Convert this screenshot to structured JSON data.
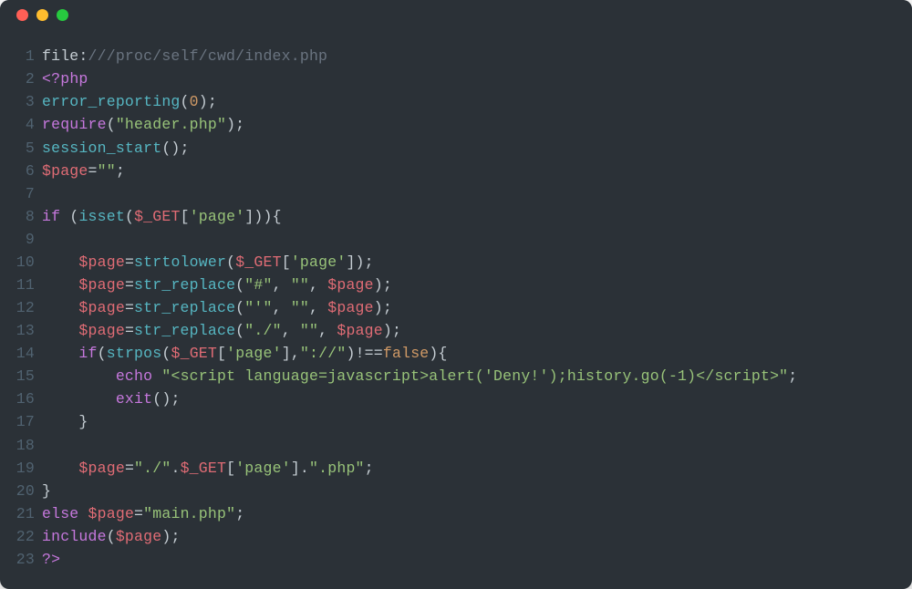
{
  "lines": [
    {
      "n": "1",
      "tokens": [
        {
          "t": "file:",
          "c": "c-plain"
        },
        {
          "t": "///proc/self/cwd/index.php",
          "c": "c-comment"
        }
      ]
    },
    {
      "n": "2",
      "tokens": [
        {
          "t": "<?",
          "c": "c-tag"
        },
        {
          "t": "php",
          "c": "c-tag"
        }
      ]
    },
    {
      "n": "3",
      "tokens": [
        {
          "t": "error_reporting",
          "c": "c-func"
        },
        {
          "t": "(",
          "c": "c-paren"
        },
        {
          "t": "0",
          "c": "c-number"
        },
        {
          "t": ");",
          "c": "c-paren"
        }
      ]
    },
    {
      "n": "4",
      "tokens": [
        {
          "t": "require",
          "c": "c-keyword"
        },
        {
          "t": "(",
          "c": "c-paren"
        },
        {
          "t": "\"header.php\"",
          "c": "c-string"
        },
        {
          "t": ");",
          "c": "c-paren"
        }
      ]
    },
    {
      "n": "5",
      "tokens": [
        {
          "t": "session_start",
          "c": "c-func"
        },
        {
          "t": "();",
          "c": "c-paren"
        }
      ]
    },
    {
      "n": "6",
      "tokens": [
        {
          "t": "$page",
          "c": "c-var"
        },
        {
          "t": "=",
          "c": "c-op"
        },
        {
          "t": "\"\"",
          "c": "c-string"
        },
        {
          "t": ";",
          "c": "c-paren"
        }
      ]
    },
    {
      "n": "7",
      "tokens": []
    },
    {
      "n": "8",
      "tokens": [
        {
          "t": "if",
          "c": "c-keyword"
        },
        {
          "t": " (",
          "c": "c-paren"
        },
        {
          "t": "isset",
          "c": "c-func"
        },
        {
          "t": "(",
          "c": "c-paren"
        },
        {
          "t": "$_GET",
          "c": "c-var"
        },
        {
          "t": "[",
          "c": "c-paren"
        },
        {
          "t": "'page'",
          "c": "c-string"
        },
        {
          "t": "])){",
          "c": "c-paren"
        }
      ]
    },
    {
      "n": "9",
      "tokens": []
    },
    {
      "n": "10",
      "tokens": [
        {
          "t": "    ",
          "c": "c-plain"
        },
        {
          "t": "$page",
          "c": "c-var"
        },
        {
          "t": "=",
          "c": "c-op"
        },
        {
          "t": "strtolower",
          "c": "c-func"
        },
        {
          "t": "(",
          "c": "c-paren"
        },
        {
          "t": "$_GET",
          "c": "c-var"
        },
        {
          "t": "[",
          "c": "c-paren"
        },
        {
          "t": "'page'",
          "c": "c-string"
        },
        {
          "t": "]);",
          "c": "c-paren"
        }
      ]
    },
    {
      "n": "11",
      "tokens": [
        {
          "t": "    ",
          "c": "c-plain"
        },
        {
          "t": "$page",
          "c": "c-var"
        },
        {
          "t": "=",
          "c": "c-op"
        },
        {
          "t": "str_replace",
          "c": "c-func"
        },
        {
          "t": "(",
          "c": "c-paren"
        },
        {
          "t": "\"#\"",
          "c": "c-string"
        },
        {
          "t": ", ",
          "c": "c-paren"
        },
        {
          "t": "\"\"",
          "c": "c-string"
        },
        {
          "t": ", ",
          "c": "c-paren"
        },
        {
          "t": "$page",
          "c": "c-var"
        },
        {
          "t": ");",
          "c": "c-paren"
        }
      ]
    },
    {
      "n": "12",
      "tokens": [
        {
          "t": "    ",
          "c": "c-plain"
        },
        {
          "t": "$page",
          "c": "c-var"
        },
        {
          "t": "=",
          "c": "c-op"
        },
        {
          "t": "str_replace",
          "c": "c-func"
        },
        {
          "t": "(",
          "c": "c-paren"
        },
        {
          "t": "\"'\"",
          "c": "c-string"
        },
        {
          "t": ", ",
          "c": "c-paren"
        },
        {
          "t": "\"\"",
          "c": "c-string"
        },
        {
          "t": ", ",
          "c": "c-paren"
        },
        {
          "t": "$page",
          "c": "c-var"
        },
        {
          "t": ");",
          "c": "c-paren"
        }
      ]
    },
    {
      "n": "13",
      "tokens": [
        {
          "t": "    ",
          "c": "c-plain"
        },
        {
          "t": "$page",
          "c": "c-var"
        },
        {
          "t": "=",
          "c": "c-op"
        },
        {
          "t": "str_replace",
          "c": "c-func"
        },
        {
          "t": "(",
          "c": "c-paren"
        },
        {
          "t": "\"./\"",
          "c": "c-string"
        },
        {
          "t": ", ",
          "c": "c-paren"
        },
        {
          "t": "\"\"",
          "c": "c-string"
        },
        {
          "t": ", ",
          "c": "c-paren"
        },
        {
          "t": "$page",
          "c": "c-var"
        },
        {
          "t": ");",
          "c": "c-paren"
        }
      ]
    },
    {
      "n": "14",
      "tokens": [
        {
          "t": "    ",
          "c": "c-plain"
        },
        {
          "t": "if",
          "c": "c-keyword"
        },
        {
          "t": "(",
          "c": "c-paren"
        },
        {
          "t": "strpos",
          "c": "c-func"
        },
        {
          "t": "(",
          "c": "c-paren"
        },
        {
          "t": "$_GET",
          "c": "c-var"
        },
        {
          "t": "[",
          "c": "c-paren"
        },
        {
          "t": "'page'",
          "c": "c-string"
        },
        {
          "t": "],",
          "c": "c-paren"
        },
        {
          "t": "\"://\"",
          "c": "c-string"
        },
        {
          "t": ")!==",
          "c": "c-op"
        },
        {
          "t": "false",
          "c": "c-bool"
        },
        {
          "t": "){",
          "c": "c-paren"
        }
      ]
    },
    {
      "n": "15",
      "tokens": [
        {
          "t": "        ",
          "c": "c-plain"
        },
        {
          "t": "echo",
          "c": "c-keyword"
        },
        {
          "t": " ",
          "c": "c-plain"
        },
        {
          "t": "\"<script language=javascript>alert('Deny!');history.go(-1)</script>\"",
          "c": "c-string"
        },
        {
          "t": ";",
          "c": "c-paren"
        }
      ]
    },
    {
      "n": "16",
      "tokens": [
        {
          "t": "        ",
          "c": "c-plain"
        },
        {
          "t": "exit",
          "c": "c-keyword"
        },
        {
          "t": "();",
          "c": "c-paren"
        }
      ]
    },
    {
      "n": "17",
      "tokens": [
        {
          "t": "    }",
          "c": "c-paren"
        }
      ]
    },
    {
      "n": "18",
      "tokens": []
    },
    {
      "n": "19",
      "tokens": [
        {
          "t": "    ",
          "c": "c-plain"
        },
        {
          "t": "$page",
          "c": "c-var"
        },
        {
          "t": "=",
          "c": "c-op"
        },
        {
          "t": "\"./\"",
          "c": "c-string"
        },
        {
          "t": ".",
          "c": "c-op"
        },
        {
          "t": "$_GET",
          "c": "c-var"
        },
        {
          "t": "[",
          "c": "c-paren"
        },
        {
          "t": "'page'",
          "c": "c-string"
        },
        {
          "t": "].",
          "c": "c-op"
        },
        {
          "t": "\".php\"",
          "c": "c-string"
        },
        {
          "t": ";",
          "c": "c-paren"
        }
      ]
    },
    {
      "n": "20",
      "tokens": [
        {
          "t": "}",
          "c": "c-paren"
        }
      ]
    },
    {
      "n": "21",
      "tokens": [
        {
          "t": "else",
          "c": "c-keyword"
        },
        {
          "t": " ",
          "c": "c-plain"
        },
        {
          "t": "$page",
          "c": "c-var"
        },
        {
          "t": "=",
          "c": "c-op"
        },
        {
          "t": "\"main.php\"",
          "c": "c-string"
        },
        {
          "t": ";",
          "c": "c-paren"
        }
      ]
    },
    {
      "n": "22",
      "tokens": [
        {
          "t": "include",
          "c": "c-keyword"
        },
        {
          "t": "(",
          "c": "c-paren"
        },
        {
          "t": "$page",
          "c": "c-var"
        },
        {
          "t": ");",
          "c": "c-paren"
        }
      ]
    },
    {
      "n": "23",
      "tokens": [
        {
          "t": "?>",
          "c": "c-tag"
        }
      ]
    }
  ]
}
